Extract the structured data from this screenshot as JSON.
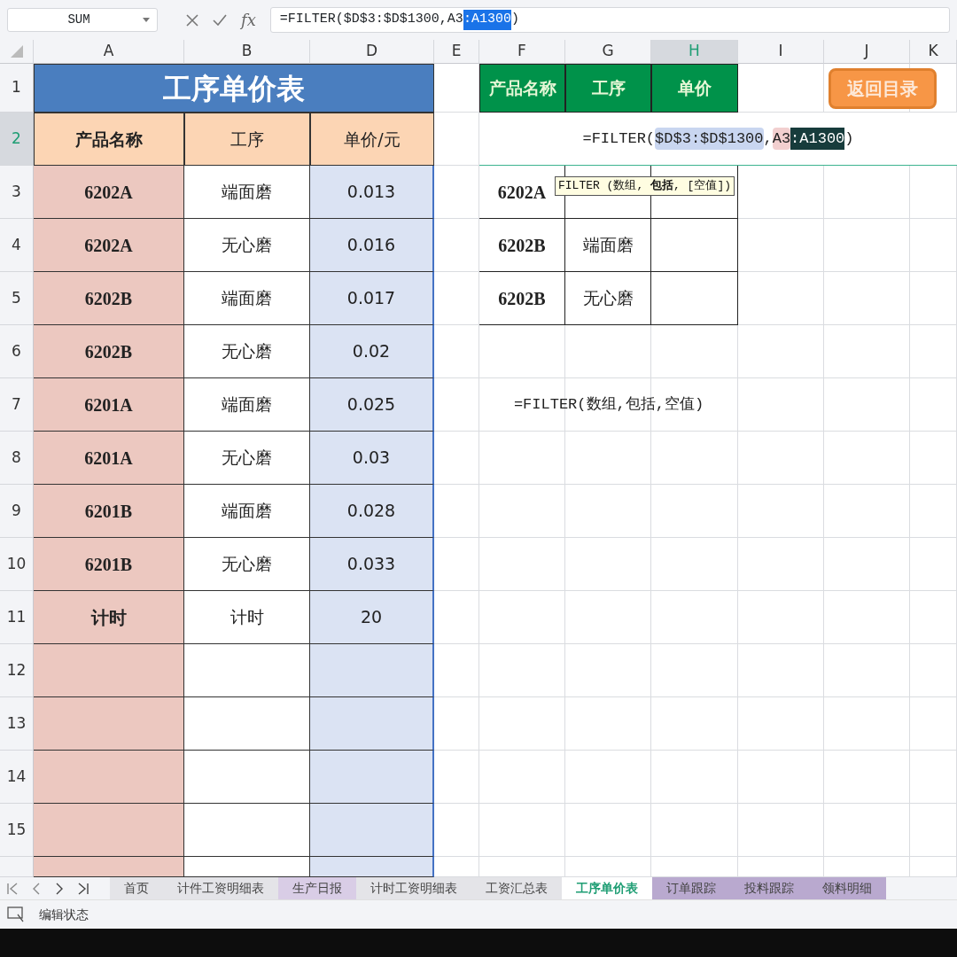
{
  "name_box": "SUM",
  "function_label": "fx",
  "formula_bar": [
    {
      "text": "=FILTER($D$3:$D$1300,A3",
      "kind": "plain"
    },
    {
      "text": ":A1300",
      "kind": "selected"
    },
    {
      "text": ")",
      "kind": "plain"
    }
  ],
  "columns": [
    {
      "label": "A",
      "selected": false
    },
    {
      "label": "B",
      "selected": false
    },
    {
      "label": "D",
      "selected": false
    },
    {
      "label": "E",
      "selected": false
    },
    {
      "label": "F",
      "selected": false
    },
    {
      "label": "G",
      "selected": false
    },
    {
      "label": "H",
      "selected": true
    },
    {
      "label": "I",
      "selected": false
    },
    {
      "label": "J",
      "selected": false
    },
    {
      "label": "K",
      "selected": false
    }
  ],
  "rows": [
    {
      "label": "1",
      "selected": false
    },
    {
      "label": "2",
      "selected": true
    },
    {
      "label": "3",
      "selected": false
    },
    {
      "label": "4",
      "selected": false
    },
    {
      "label": "5",
      "selected": false
    },
    {
      "label": "6",
      "selected": false
    },
    {
      "label": "7",
      "selected": false
    },
    {
      "label": "8",
      "selected": false
    },
    {
      "label": "9",
      "selected": false
    },
    {
      "label": "10",
      "selected": false
    },
    {
      "label": "11",
      "selected": false
    },
    {
      "label": "12",
      "selected": false
    },
    {
      "label": "13",
      "selected": false
    },
    {
      "label": "14",
      "selected": false
    },
    {
      "label": "15",
      "selected": false
    }
  ],
  "price_table": {
    "title": "工序单价表",
    "headers": [
      "产品名称",
      "工序",
      "单价/元"
    ],
    "rows": [
      [
        "6202A",
        "端面磨",
        "0.013"
      ],
      [
        "6202A",
        "无心磨",
        "0.016"
      ],
      [
        "6202B",
        "端面磨",
        "0.017"
      ],
      [
        "6202B",
        "无心磨",
        "0.02"
      ],
      [
        "6201A",
        "端面磨",
        "0.025"
      ],
      [
        "6201A",
        "无心磨",
        "0.03"
      ],
      [
        "6201B",
        "端面磨",
        "0.028"
      ],
      [
        "6201B",
        "无心磨",
        "0.033"
      ],
      [
        "计时",
        "计时",
        "20"
      ]
    ]
  },
  "lookup_table": {
    "headers": [
      "产品名称",
      "工序",
      "单价"
    ],
    "editing_formula": [
      {
        "text": "=FILTER(",
        "kind": "plain"
      },
      {
        "text": "$D$3:$D$1300",
        "kind": "blue"
      },
      {
        "text": ",",
        "kind": "plain"
      },
      {
        "text": "A3",
        "kind": "pink"
      },
      {
        "text": ":A1300",
        "kind": "selected"
      },
      {
        "text": ")",
        "kind": "plain"
      }
    ],
    "rows": [
      {
        "product": "6202A"
      },
      {
        "product": "6202B",
        "process": "端面磨"
      },
      {
        "product": "6202B",
        "process": "无心磨"
      }
    ]
  },
  "tooltip": "FILTER (数组, **包括**, [空值])",
  "note": "=FILTER(数组,包括,空值)",
  "back_button": "返回目录",
  "sheet_tabs": [
    {
      "label": "首页",
      "selected": false,
      "color": "#e4e4e8"
    },
    {
      "label": "计件工资明细表",
      "selected": false,
      "color": "#e4e4e8"
    },
    {
      "label": "生产日报",
      "selected": false,
      "color": "#d9cde6"
    },
    {
      "label": "计时工资明细表",
      "selected": false,
      "color": "#e4e4e8"
    },
    {
      "label": "工资汇总表",
      "selected": false,
      "color": "#e4e4e8"
    },
    {
      "label": "工序单价表",
      "selected": true,
      "color": "#ffffff"
    },
    {
      "label": "订单跟踪",
      "selected": false,
      "color": "#b9a9cf"
    },
    {
      "label": "投料跟踪",
      "selected": false,
      "color": "#b9a9cf"
    },
    {
      "label": "领料明细",
      "selected": false,
      "color": "#b9a9cf"
    }
  ],
  "status_bar": {
    "text": "编辑状态"
  }
}
